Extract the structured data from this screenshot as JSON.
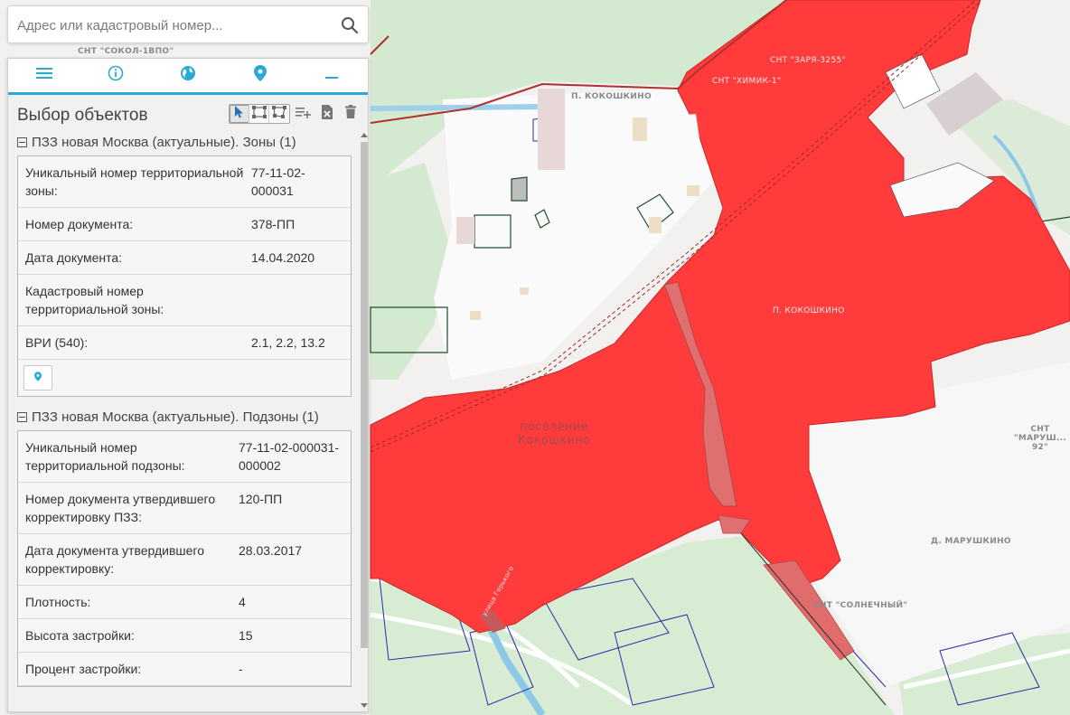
{
  "search": {
    "placeholder": "Адрес или кадастровый номер..."
  },
  "toolbar": {
    "items": [
      {
        "name": "menu-icon"
      },
      {
        "name": "info-icon"
      },
      {
        "name": "globe-icon"
      },
      {
        "name": "map-pin-icon"
      },
      {
        "name": "minimize-icon"
      }
    ],
    "accent": "#29a9d8"
  },
  "panel": {
    "title": "Выбор объектов",
    "tools": [
      "pointer-select-icon",
      "rect-select-icon",
      "polygon-select-icon",
      "add-to-list-icon",
      "clear-selection-icon",
      "delete-icon"
    ],
    "sections": [
      {
        "header": "ПЗЗ новая Москва (актуальные). Зоны (1)",
        "rows": [
          {
            "key": "Уникальный номер территориальной зоны:",
            "value": "77-11-02-000031"
          },
          {
            "key": "Номер документа:",
            "value": "378-ПП"
          },
          {
            "key": "Дата документа:",
            "value": "14.04.2020"
          },
          {
            "key": "Кадастровый номер территориальной зоны:",
            "value": ""
          },
          {
            "key": "ВРИ (540):",
            "value": "2.1, 2.2, 13.2"
          }
        ]
      },
      {
        "header": "ПЗЗ новая Москва (актуальные). Подзоны (1)",
        "rows": [
          {
            "key": "Уникальный номер территориальной подзоны:",
            "value": "77-11-02-000031-000002"
          },
          {
            "key": "Номер документа утвердившего корректировку ПЗЗ:",
            "value": "120-ПП"
          },
          {
            "key": "Дата документа утвердившего корректировку:",
            "value": "28.03.2017"
          },
          {
            "key": "Плотность:",
            "value": "4"
          },
          {
            "key": "Высота застройки:",
            "value": "15"
          },
          {
            "key": "Процент застройки:",
            "value": "-"
          }
        ]
      }
    ]
  },
  "map": {
    "labels": {
      "sokol": "СНТ \"СОКОЛ-1ВПО\"",
      "p_kokoshkino_top": "П. КОКОШКИНО",
      "zarya": "СНТ \"ЗАРЯ-3255\"",
      "khimik": "СНТ \"ХИМИК-1\"",
      "p_kokoshkino_mid": "П. КОКОШКИНО",
      "marushkino_snt": "СНТ \"МАРУШ... 92\"",
      "settlement": "поселение Кокошкино",
      "d_marushkino": "Д. МАРУШКИНО",
      "solnechny": "СНТ \"СОЛНЕЧНЫЙ\"",
      "street": "улица Горького"
    },
    "colors": {
      "zone": "#ff3b3b",
      "subzone": "#e07070",
      "forest": "#d6ebd2",
      "water": "#8ec8e8",
      "boundary": "#b03030"
    }
  }
}
